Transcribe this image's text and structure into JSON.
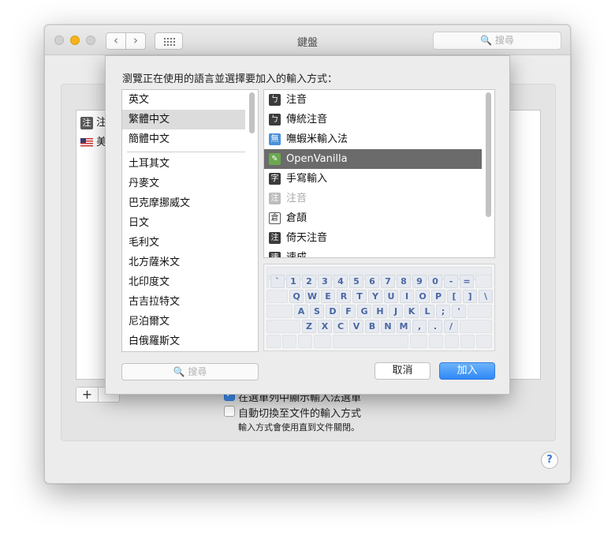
{
  "window": {
    "title": "鍵盤",
    "search_placeholder": "🔍 搜尋",
    "back_icon": "‹",
    "forward_icon": "›"
  },
  "background_list": {
    "items": [
      {
        "icon": "注",
        "label": "注"
      },
      {
        "icon": "flag-us",
        "label": "美"
      }
    ]
  },
  "options": {
    "show_menu_label": "在選單列中顯示輸入法選單",
    "show_menu_checked": true,
    "auto_switch_label": "自動切換至文件的輸入方式",
    "auto_switch_checked": false,
    "note": "輸入方式會使用直到文件關閉。"
  },
  "buttons": {
    "plus": "+",
    "minus": "−",
    "help": "?"
  },
  "sheet": {
    "prompt": "瀏覽正在使用的語言並選擇要加入的輸入方式：",
    "languages": [
      "英文",
      "繁體中文",
      "簡體中文",
      "土耳其文",
      "丹麥文",
      "巴克摩挪威文",
      "日文",
      "毛利文",
      "北方薩米文",
      "北印度文",
      "古吉拉特文",
      "尼泊爾文",
      "白俄羅斯文"
    ],
    "selected_language": "繁體中文",
    "methods": [
      {
        "icon": "ㄅ",
        "label": "注音",
        "state": "normal"
      },
      {
        "icon": "ㄅ",
        "label": "傳統注音",
        "state": "normal"
      },
      {
        "icon": "無",
        "label": "嘸蝦米輸入法",
        "state": "normal"
      },
      {
        "icon": "✎",
        "label": "OpenVanilla",
        "state": "selected"
      },
      {
        "icon": "字",
        "label": "手寫輸入",
        "state": "normal"
      },
      {
        "icon": "注",
        "label": "注音",
        "state": "disabled"
      },
      {
        "icon": "倉",
        "label": "倉頡",
        "state": "normal"
      },
      {
        "icon": "注",
        "label": "倚天注音",
        "state": "normal"
      },
      {
        "icon": "速",
        "label": "速成",
        "state": "normal"
      }
    ],
    "keyboard_rows": [
      [
        "`",
        "1",
        "2",
        "3",
        "4",
        "5",
        "6",
        "7",
        "8",
        "9",
        "0",
        "-",
        "="
      ],
      [
        "Q",
        "W",
        "E",
        "R",
        "T",
        "Y",
        "U",
        "I",
        "O",
        "P",
        "[",
        "]",
        "\\"
      ],
      [
        "A",
        "S",
        "D",
        "F",
        "G",
        "H",
        "J",
        "K",
        "L",
        ";",
        "'"
      ],
      [
        "Z",
        "X",
        "C",
        "V",
        "B",
        "N",
        "M",
        ",",
        ".",
        "/"
      ]
    ],
    "search_placeholder": "🔍 搜尋",
    "cancel_label": "取消",
    "add_label": "加入"
  }
}
